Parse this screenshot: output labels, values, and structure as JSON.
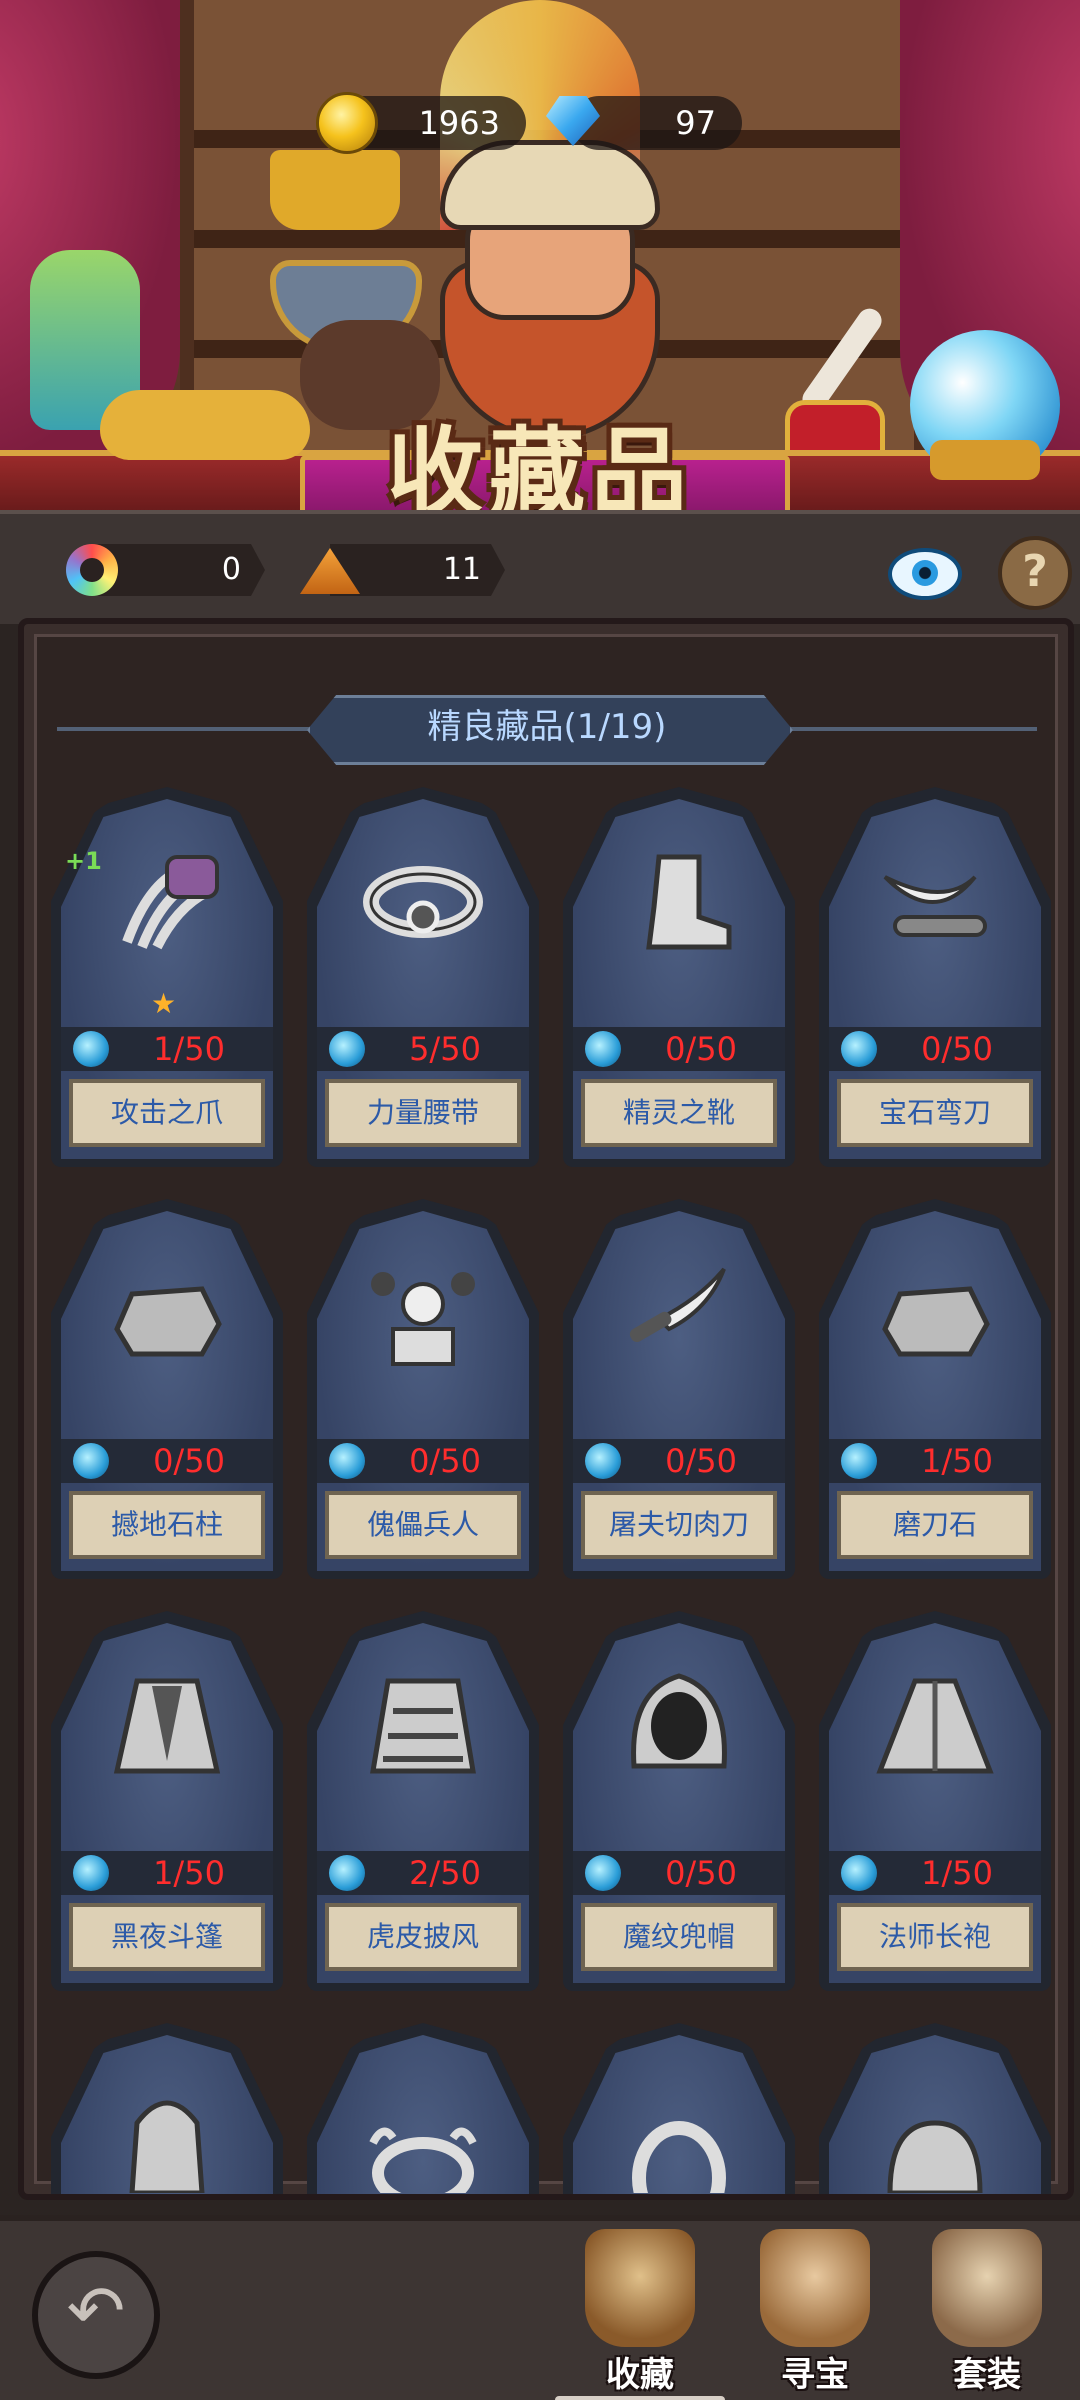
{
  "currency": {
    "gold": "1963",
    "gems": "97"
  },
  "header": {
    "title": "收藏品"
  },
  "status": {
    "essence": "0",
    "sand": "11"
  },
  "section": {
    "title": "精良藏品(1/19)"
  },
  "items": [
    {
      "name": "攻击之爪",
      "count": "1/50",
      "plus": "+1"
    },
    {
      "name": "力量腰带",
      "count": "5/50"
    },
    {
      "name": "精灵之靴",
      "count": "0/50"
    },
    {
      "name": "宝石弯刀",
      "count": "0/50"
    },
    {
      "name": "撼地石柱",
      "count": "0/50"
    },
    {
      "name": "傀儡兵人",
      "count": "0/50"
    },
    {
      "name": "屠夫切肉刀",
      "count": "0/50"
    },
    {
      "name": "磨刀石",
      "count": "1/50"
    },
    {
      "name": "黑夜斗篷",
      "count": "1/50"
    },
    {
      "name": "虎皮披风",
      "count": "2/50"
    },
    {
      "name": "魔纹兜帽",
      "count": "0/50"
    },
    {
      "name": "法师长袍",
      "count": "1/50"
    }
  ],
  "nav": {
    "collect": "收藏",
    "treasure": "寻宝",
    "set": "套装"
  },
  "colors": {
    "count_red": "#ff2d2d",
    "name_blue": "#2c5aa8",
    "card_blue": "#4d5e82"
  }
}
